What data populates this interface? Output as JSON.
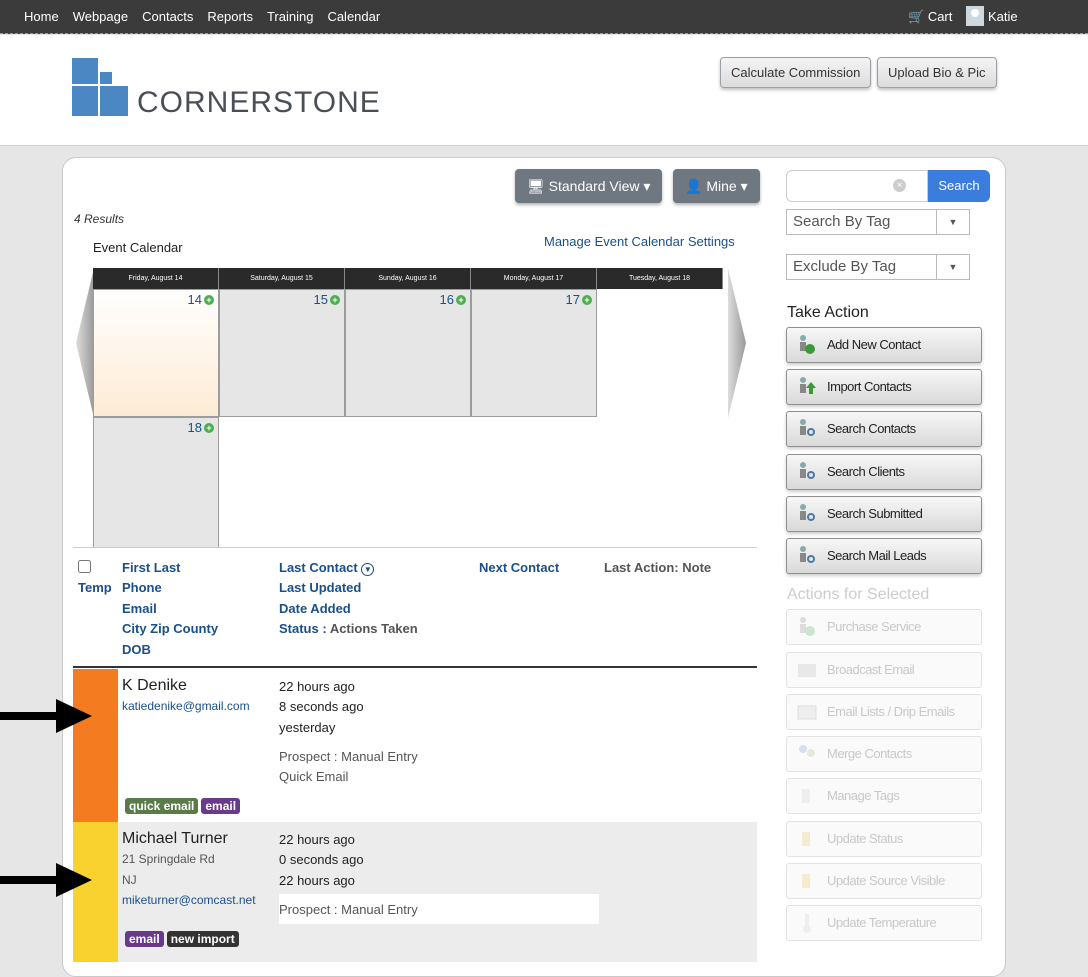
{
  "nav": {
    "items": [
      "Home",
      "Webpage",
      "Contacts",
      "Reports",
      "Training",
      "Calendar"
    ],
    "cart": "Cart",
    "user": "Katie"
  },
  "header": {
    "logo": "CORNERSTONE",
    "buttons": [
      "Calculate Commission",
      "Upload Bio & Pic"
    ]
  },
  "views": {
    "standard": "Standard View",
    "mine": "Mine"
  },
  "results_count": "4 Results",
  "calendar": {
    "title": "Event Calendar",
    "manage_link": "Manage Event Calendar Settings",
    "day_headers": [
      "Friday, August 14",
      "Saturday, August 15",
      "Sunday, August 16",
      "Monday, August 17",
      "Tuesday, August 18"
    ],
    "day_numbers": [
      "14",
      "15",
      "16",
      "17",
      "18"
    ]
  },
  "columns": {
    "temp": "Temp",
    "col1": [
      "First Last",
      "Phone",
      "Email",
      "City Zip County",
      "DOB"
    ],
    "col2": [
      "Last Contact",
      "Last Updated",
      "Date Added"
    ],
    "status_label": "Status :",
    "status_value": "Actions Taken",
    "next_contact": "Next Contact",
    "last_action": "Last Action: Note"
  },
  "rows": [
    {
      "name": "K Denike",
      "email": "katiedenike@gmail.com",
      "last_contact": "22 hours ago",
      "last_updated": "8 seconds ago",
      "date_added": "yesterday",
      "status": "Prospect : Manual Entry",
      "action": "Quick Email",
      "tags": [
        "quick email",
        "email"
      ],
      "color": "#f47b20"
    },
    {
      "name": "Michael Turner",
      "address": "21 Springdale Rd",
      "state": "NJ",
      "email": "miketurner@comcast.net",
      "last_contact": "22 hours ago",
      "last_updated": "0 seconds ago",
      "date_added": "22 hours ago",
      "status": "Prospect : Manual Entry",
      "tags": [
        "email",
        "new import"
      ],
      "color": "#f9d230"
    }
  ],
  "sidebar": {
    "search_button": "Search",
    "search_by_tag": "Search By Tag",
    "exclude_by_tag": "Exclude By Tag",
    "take_action_title": "Take Action",
    "actions": [
      "Add New Contact",
      "Import Contacts",
      "Search Contacts",
      "Search Clients",
      "Search Submitted",
      "Search Mail Leads"
    ],
    "selected_title": "Actions for Selected",
    "selected_actions": [
      "Purchase Service",
      "Broadcast Email",
      "Email Lists / Drip Emails",
      "Merge Contacts",
      "Manage Tags",
      "Update Status",
      "Update Source Visible",
      "Update Temperature"
    ]
  },
  "colors": {
    "accent": "#3b7ddd",
    "link": "#1a4f8a",
    "tag_green": "#5a7a4a",
    "tag_purple": "#6a3a8a",
    "tag_dark": "#333333"
  }
}
